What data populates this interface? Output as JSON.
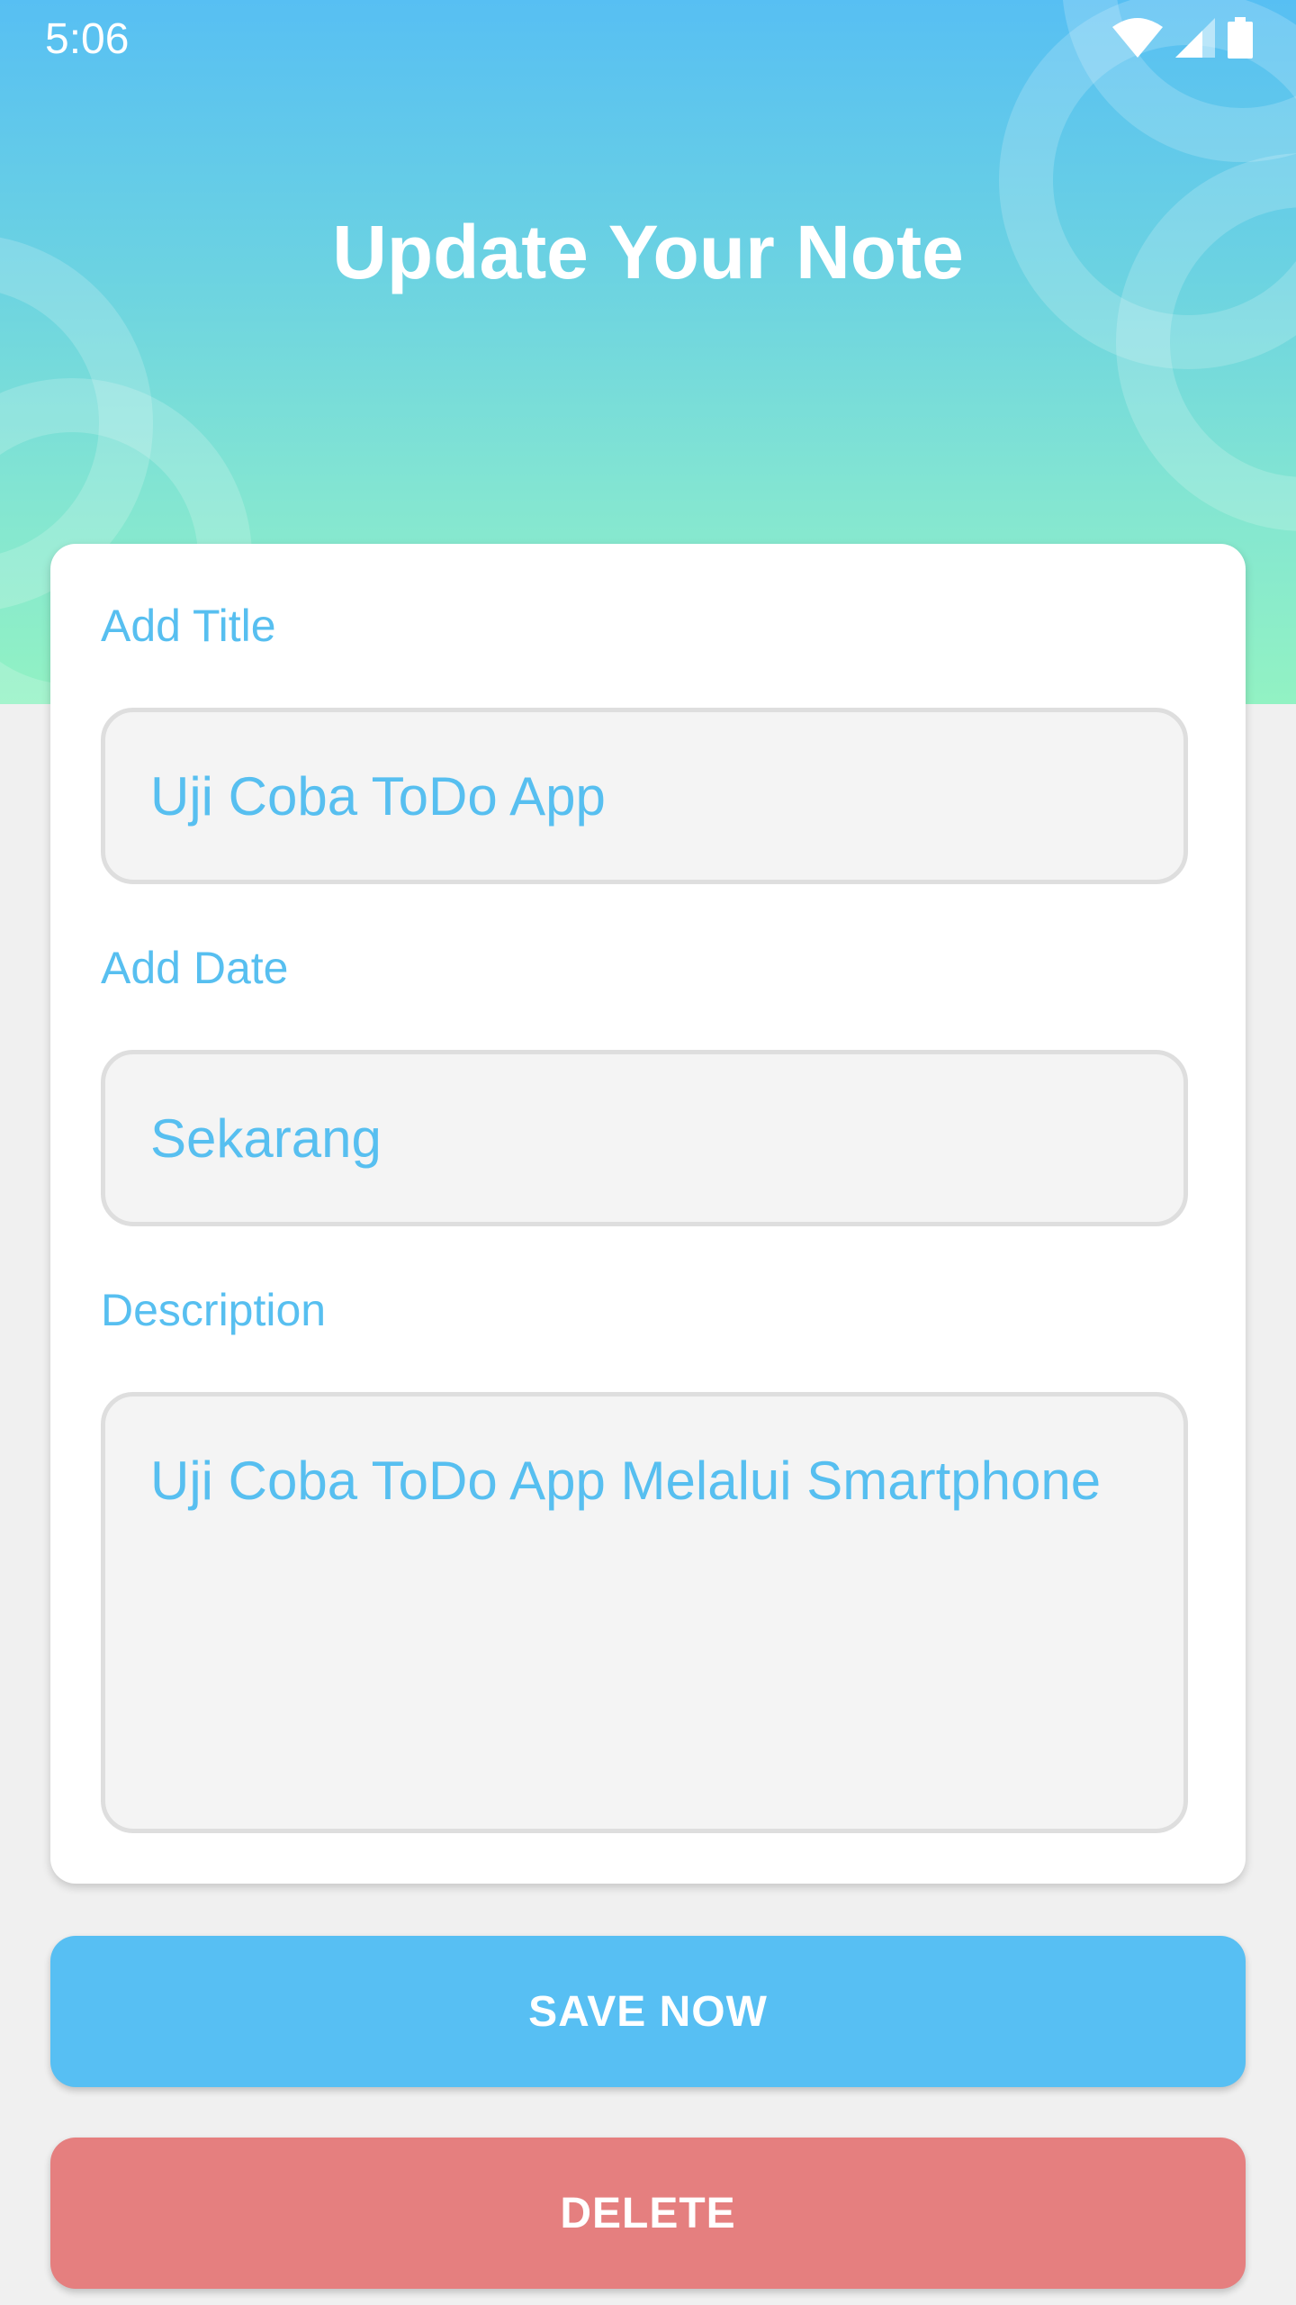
{
  "status_bar": {
    "time": "5:06"
  },
  "header": {
    "title": "Update Your Note"
  },
  "form": {
    "title_label": "Add Title",
    "title_value": "Uji Coba ToDo App",
    "date_label": "Add Date",
    "date_value": "Sekarang",
    "description_label": "Description",
    "description_value": "Uji Coba ToDo App Melalui Smartphone"
  },
  "actions": {
    "save_label": "SAVE NOW",
    "delete_label": "DELETE"
  },
  "icons": [
    "wifi-icon",
    "cell-signal-icon",
    "battery-icon"
  ],
  "colors": {
    "accent": "#57bff3",
    "header_bottom": "#92f2c3",
    "delete": "#e57f7f",
    "field_text": "#57bff0",
    "background": "#f0f0f0"
  }
}
